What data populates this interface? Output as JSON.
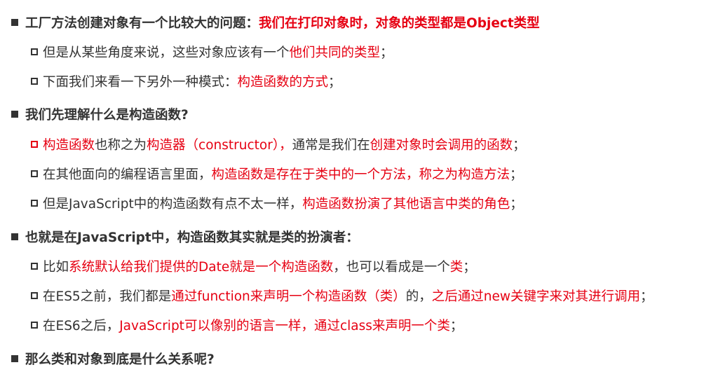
{
  "colors": {
    "text": "#333333",
    "highlight": "#e60012"
  },
  "sections": [
    {
      "heading": [
        {
          "text": "工厂方法创建对象有一个比较大的问题：",
          "red": false
        },
        {
          "text": "我们在打印对象时，对象的类型都是Object类型",
          "red": true
        }
      ],
      "bullets": [
        {
          "marker_red": false,
          "segs": [
            {
              "text": "但是从某些角度来说，这些对象应该有一个",
              "red": false
            },
            {
              "text": "他们共同的类型",
              "red": true
            },
            {
              "text": "；",
              "red": false
            }
          ]
        },
        {
          "marker_red": false,
          "segs": [
            {
              "text": "下面我们来看一下另外一种模式：",
              "red": false
            },
            {
              "text": "构造函数的方式",
              "red": true
            },
            {
              "text": "；",
              "red": false
            }
          ]
        }
      ]
    },
    {
      "heading": [
        {
          "text": "我们先理解什么是构造函数?",
          "red": false
        }
      ],
      "bullets": [
        {
          "marker_red": true,
          "segs": [
            {
              "text": "构造函数",
              "red": true
            },
            {
              "text": "也称之为",
              "red": false
            },
            {
              "text": "构造器（constructor），",
              "red": true
            },
            {
              "text": "通常是我们在",
              "red": false
            },
            {
              "text": "创建对象时会调用的函数",
              "red": true
            },
            {
              "text": "；",
              "red": false
            }
          ]
        },
        {
          "marker_red": false,
          "segs": [
            {
              "text": "在其他面向的编程语言里面，",
              "red": false
            },
            {
              "text": "构造函数是存在于类中的一个方法，称之为构造方法",
              "red": true
            },
            {
              "text": "；",
              "red": false
            }
          ]
        },
        {
          "marker_red": false,
          "segs": [
            {
              "text": "但是JavaScript中的构造函数有点不太一样，",
              "red": false
            },
            {
              "text": "构造函数扮演了其他语言中类的角色",
              "red": true
            },
            {
              "text": "；",
              "red": false
            }
          ]
        }
      ]
    },
    {
      "heading": [
        {
          "text": "也就是在JavaScript中，构造函数其实就是类的扮演者：",
          "red": false
        }
      ],
      "bullets": [
        {
          "marker_red": false,
          "segs": [
            {
              "text": "比如",
              "red": false
            },
            {
              "text": "系统默认给我们提供的Date就是一个构造函数",
              "red": true
            },
            {
              "text": "，也可以看成是一个",
              "red": false
            },
            {
              "text": "类",
              "red": true
            },
            {
              "text": "；",
              "red": false
            }
          ]
        },
        {
          "marker_red": false,
          "segs": [
            {
              "text": "在ES5之前，我们都是",
              "red": false
            },
            {
              "text": "通过function来声明一个构造函数（类）",
              "red": true
            },
            {
              "text": "的，",
              "red": false
            },
            {
              "text": "之后通过new关键字来对其进行调用",
              "red": true
            },
            {
              "text": "；",
              "red": false
            }
          ]
        },
        {
          "marker_red": false,
          "segs": [
            {
              "text": "在ES6之后，",
              "red": false
            },
            {
              "text": "JavaScript可以像别的语言一样，通过class来声明一个类",
              "red": true
            },
            {
              "text": "；",
              "red": false
            }
          ]
        }
      ]
    },
    {
      "heading": [
        {
          "text": "那么类和对象到底是什么关系呢?",
          "red": false
        }
      ],
      "bullets": []
    }
  ]
}
